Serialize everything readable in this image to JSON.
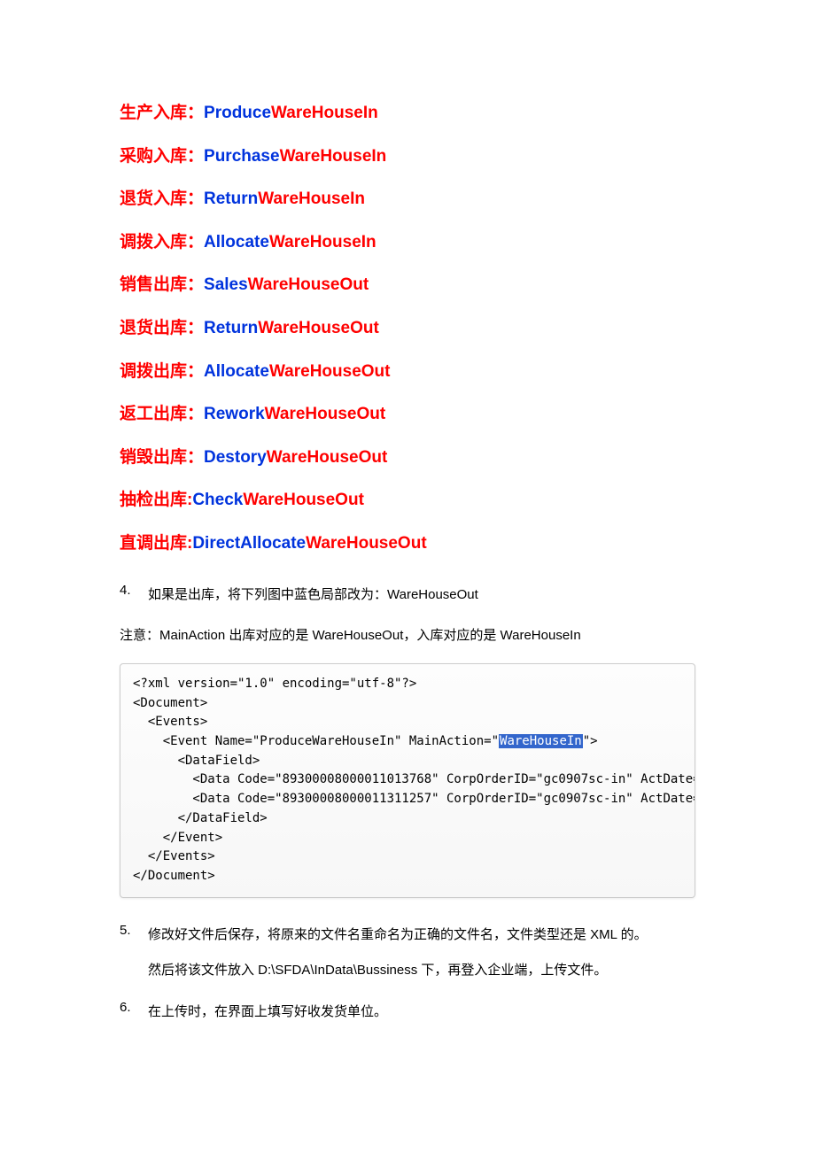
{
  "definitions": [
    {
      "label": "生产入库：",
      "prefix": "Produce",
      "suffix": "WareHouseIn"
    },
    {
      "label": "采购入库：",
      "prefix": "Purchase",
      "suffix": "WareHouseIn"
    },
    {
      "label": "退货入库：",
      "prefix": "Return",
      "suffix": "WareHouseIn"
    },
    {
      "label": "调拨入库：",
      "prefix": "Allocate",
      "suffix": "WareHouseIn"
    },
    {
      "label": "销售出库：",
      "prefix": "Sales",
      "suffix": "WareHouseOut"
    },
    {
      "label": "退货出库：",
      "prefix": "Return",
      "suffix": "WareHouseOut"
    },
    {
      "label": "调拨出库：",
      "prefix": "Allocate",
      "suffix": "WareHouseOut"
    },
    {
      "label": "返工出库：",
      "prefix": "Rework",
      "suffix": "WareHouseOut"
    },
    {
      "label": "销毁出库：",
      "prefix": "Destory",
      "suffix": "WareHouseOut"
    },
    {
      "label": "抽检出库:",
      "prefix": "Check",
      "suffix": "WareHouseOut"
    },
    {
      "label": "直调出库:",
      "prefix": "DirectAllocate",
      "suffix": "WareHouseOut"
    }
  ],
  "step4": {
    "num": "4.",
    "text": "如果是出库，将下列图中蓝色局部改为：WareHouseOut"
  },
  "note": "注意：MainAction 出库对应的是 WareHouseOut，入库对应的是 WareHouseIn",
  "code": {
    "l1": "<?xml version=\"1.0\" encoding=\"utf-8\"?>",
    "l2": "<Document>",
    "l3": "  <Events>",
    "l4a": "    <Event Name=\"ProduceWareHouseIn\" MainAction=\"",
    "l4_hl": "WareHouseIn",
    "l4b": "\">",
    "l5": "      <DataField>",
    "l6": "        <Data Code=\"89300008000011013768\" CorpOrderID=\"gc0907sc-in\" ActDate=",
    "l7": "        <Data Code=\"89300008000011311257\" CorpOrderID=\"gc0907sc-in\" ActDate=",
    "l8": "      </DataField>",
    "l9": "    </Event>",
    "l10": "  </Events>",
    "l11": "</Document>"
  },
  "step5": {
    "num": "5.",
    "line1": "修改好文件后保存，将原来的文件名重命名为正确的文件名，文件类型还是 XML 的。",
    "line2": "然后将该文件放入 D:\\SFDA\\InData\\Bussiness 下，再登入企业端，上传文件。"
  },
  "step6": {
    "num": "6.",
    "text": "在上传时，在界面上填写好收发货单位。"
  }
}
